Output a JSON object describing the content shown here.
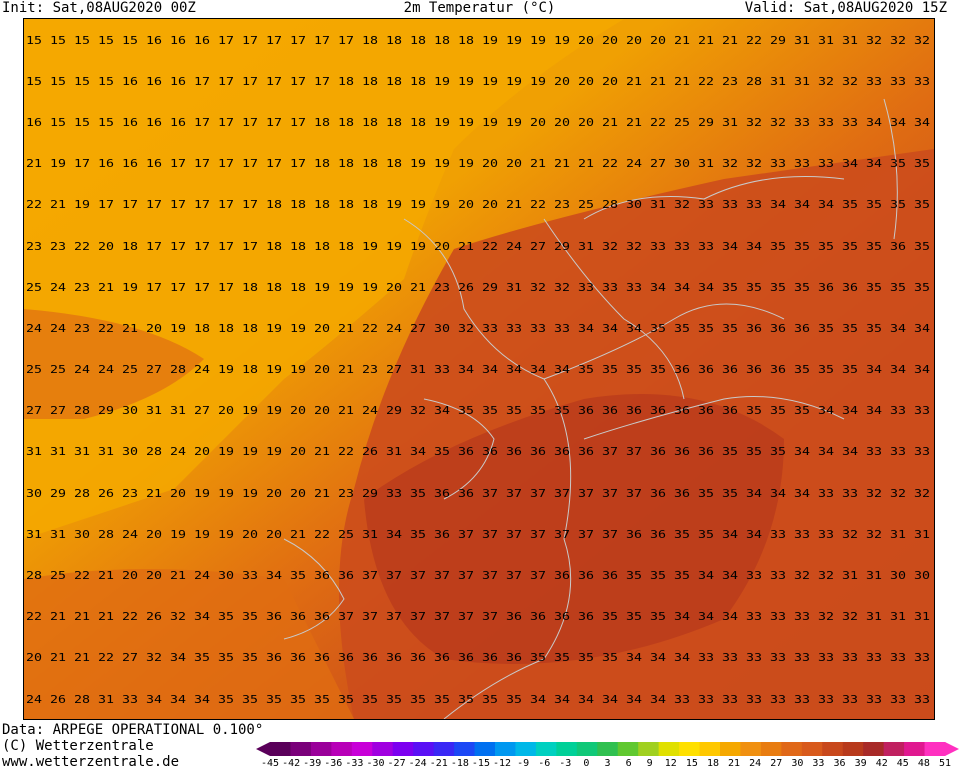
{
  "header": {
    "init": "Init: Sat,08AUG2020 00Z",
    "title": "2m Temperatur (°C)",
    "valid": "Valid: Sat,08AUG2020 15Z"
  },
  "footer": {
    "data_line": "Data: ARPEGE OPERATIONAL 0.100°",
    "copyright": "(C) Wetterzentrale",
    "website": "www.wetterzentrale.de"
  },
  "colors": {
    "cool": "#f5a800",
    "mild": "#e98a05",
    "warm": "#e06d12",
    "hot": "#c8481c",
    "hottest": "#b83a1c",
    "borders": "#c9c9c9"
  },
  "legend": {
    "ticks": [
      "-45",
      "-42",
      "-39",
      "-36",
      "-33",
      "-30",
      "-27",
      "-24",
      "-21",
      "-18",
      "-15",
      "-12",
      "-9",
      "-6",
      "-3",
      "0",
      "3",
      "6",
      "9",
      "12",
      "15",
      "18",
      "21",
      "24",
      "27",
      "30",
      "33",
      "36",
      "39",
      "42",
      "45",
      "48",
      "51"
    ],
    "colors": [
      "#5a005a",
      "#7a007a",
      "#9a009a",
      "#b800b8",
      "#c800d8",
      "#a000e0",
      "#7c00f0",
      "#5a10f5",
      "#3a28f5",
      "#1c48f5",
      "#0070f0",
      "#0098f0",
      "#00b8e8",
      "#00d0c0",
      "#00d098",
      "#10c878",
      "#30c050",
      "#60c830",
      "#a0d020",
      "#e0e000",
      "#ffe000",
      "#ffc800",
      "#f5a800",
      "#f09010",
      "#e87c10",
      "#e06818",
      "#d85a1c",
      "#c8481c",
      "#b83a1c",
      "#a82a28",
      "#c02060",
      "#e01890",
      "#ff30c0"
    ]
  },
  "map": {
    "row_values": [
      "15 15 15 15 15 16 16 16 17 17 17 17 17 17 18 18 18 18 18 19 19 19 19 20 20 20 20 21 21 21 22 29 31 31 31 32 32 32",
      "15 15 15 15 16 16 16 17 17 17 17 17 17 18 18 18 18 19 19 19 19 19 20 20 20 21 21 21 22 23 28 31 31 32 32 33 33 33",
      "16 15 15 15 16 16 16 17 17 17 17 17 18 18 18 18 18 19 19 19 19 20 20 20 21 21 22 25 29 31 32 32 33 33 33 34 34 34",
      "21 19 17 16 16 16 17 17 17 17 17 17 18 18 18 18 19 19 19 20 20 21 21 21 22 24 27 30 31 32 32 33 33 33 34 34 35 35",
      "22 21 19 17 17 17 17 17 17 17 18 18 18 18 18 19 19 19 20 20 21 22 23 25 28 30 31 32 33 33 33 34 34 34 35 35 35 35",
      "23 23 22 20 18 17 17 17 17 17 18 18 18 18 19 19 19 20 21 22 24 27 29 31 32 32 33 33 33 34 34 35 35 35 35 35 36 35",
      "25 24 23 21 19 17 17 17 17 18 18 18 19 19 19 20 21 23 26 29 31 32 32 33 33 33 34 34 34 35 35 35 35 36 36 35 35 35",
      "24 24 23 22 21 20 19 18 18 18 19 19 20 21 22 24 27 30 32 33 33 33 33 34 34 34 35 35 35 35 36 36 36 35 35 35 34 34",
      "25 25 24 24 25 27 28 24 19 18 19 19 20 21 23 27 31 33 34 34 34 34 34 35 35 35 35 36 36 36 36 36 35 35 35 34 34 34",
      "27 27 28 29 30 31 31 27 20 19 19 20 20 21 24 29 32 34 35 35 35 35 35 36 36 36 36 36 36 36 35 35 35 34 34 34 33 33",
      "31 31 31 31 30 28 24 20 19 19 19 20 21 22 26 31 34 35 36 36 36 36 36 36 37 37 36 36 36 35 35 35 34 34 34 33 33 33",
      "30 29 28 26 23 21 20 19 19 19 20 20 21 23 29 33 35 36 36 37 37 37 37 37 37 37 36 36 35 35 34 34 34 33 33 32 32 32",
      "31 31 30 28 24 20 19 19 19 20 20 21 22 25 31 34 35 36 37 37 37 37 37 37 37 36 36 35 35 34 34 33 33 33 32 32 31 31",
      "28 25 22 21 20 20 21 24 30 33 34 35 36 36 37 37 37 37 37 37 37 37 36 36 36 35 35 35 34 34 33 33 32 32 31 31 30 30",
      "22 21 21 21 22 26 32 34 35 35 36 36 36 37 37 37 37 37 37 37 36 36 36 36 35 35 35 34 34 34 33 33 33 32 32 31 31 31",
      "20 21 21 22 27 32 34 35 35 35 36 36 36 36 36 36 36 36 36 36 36 35 35 35 35 34 34 34 33 33 33 33 33 33 33 33 33 33",
      "24 26 28 31 33 34 34 34 35 35 35 35 35 35 35 35 35 35 35 35 35 34 34 34 34 34 34 33 33 33 33 33 33 33 33 33 33 33"
    ]
  }
}
